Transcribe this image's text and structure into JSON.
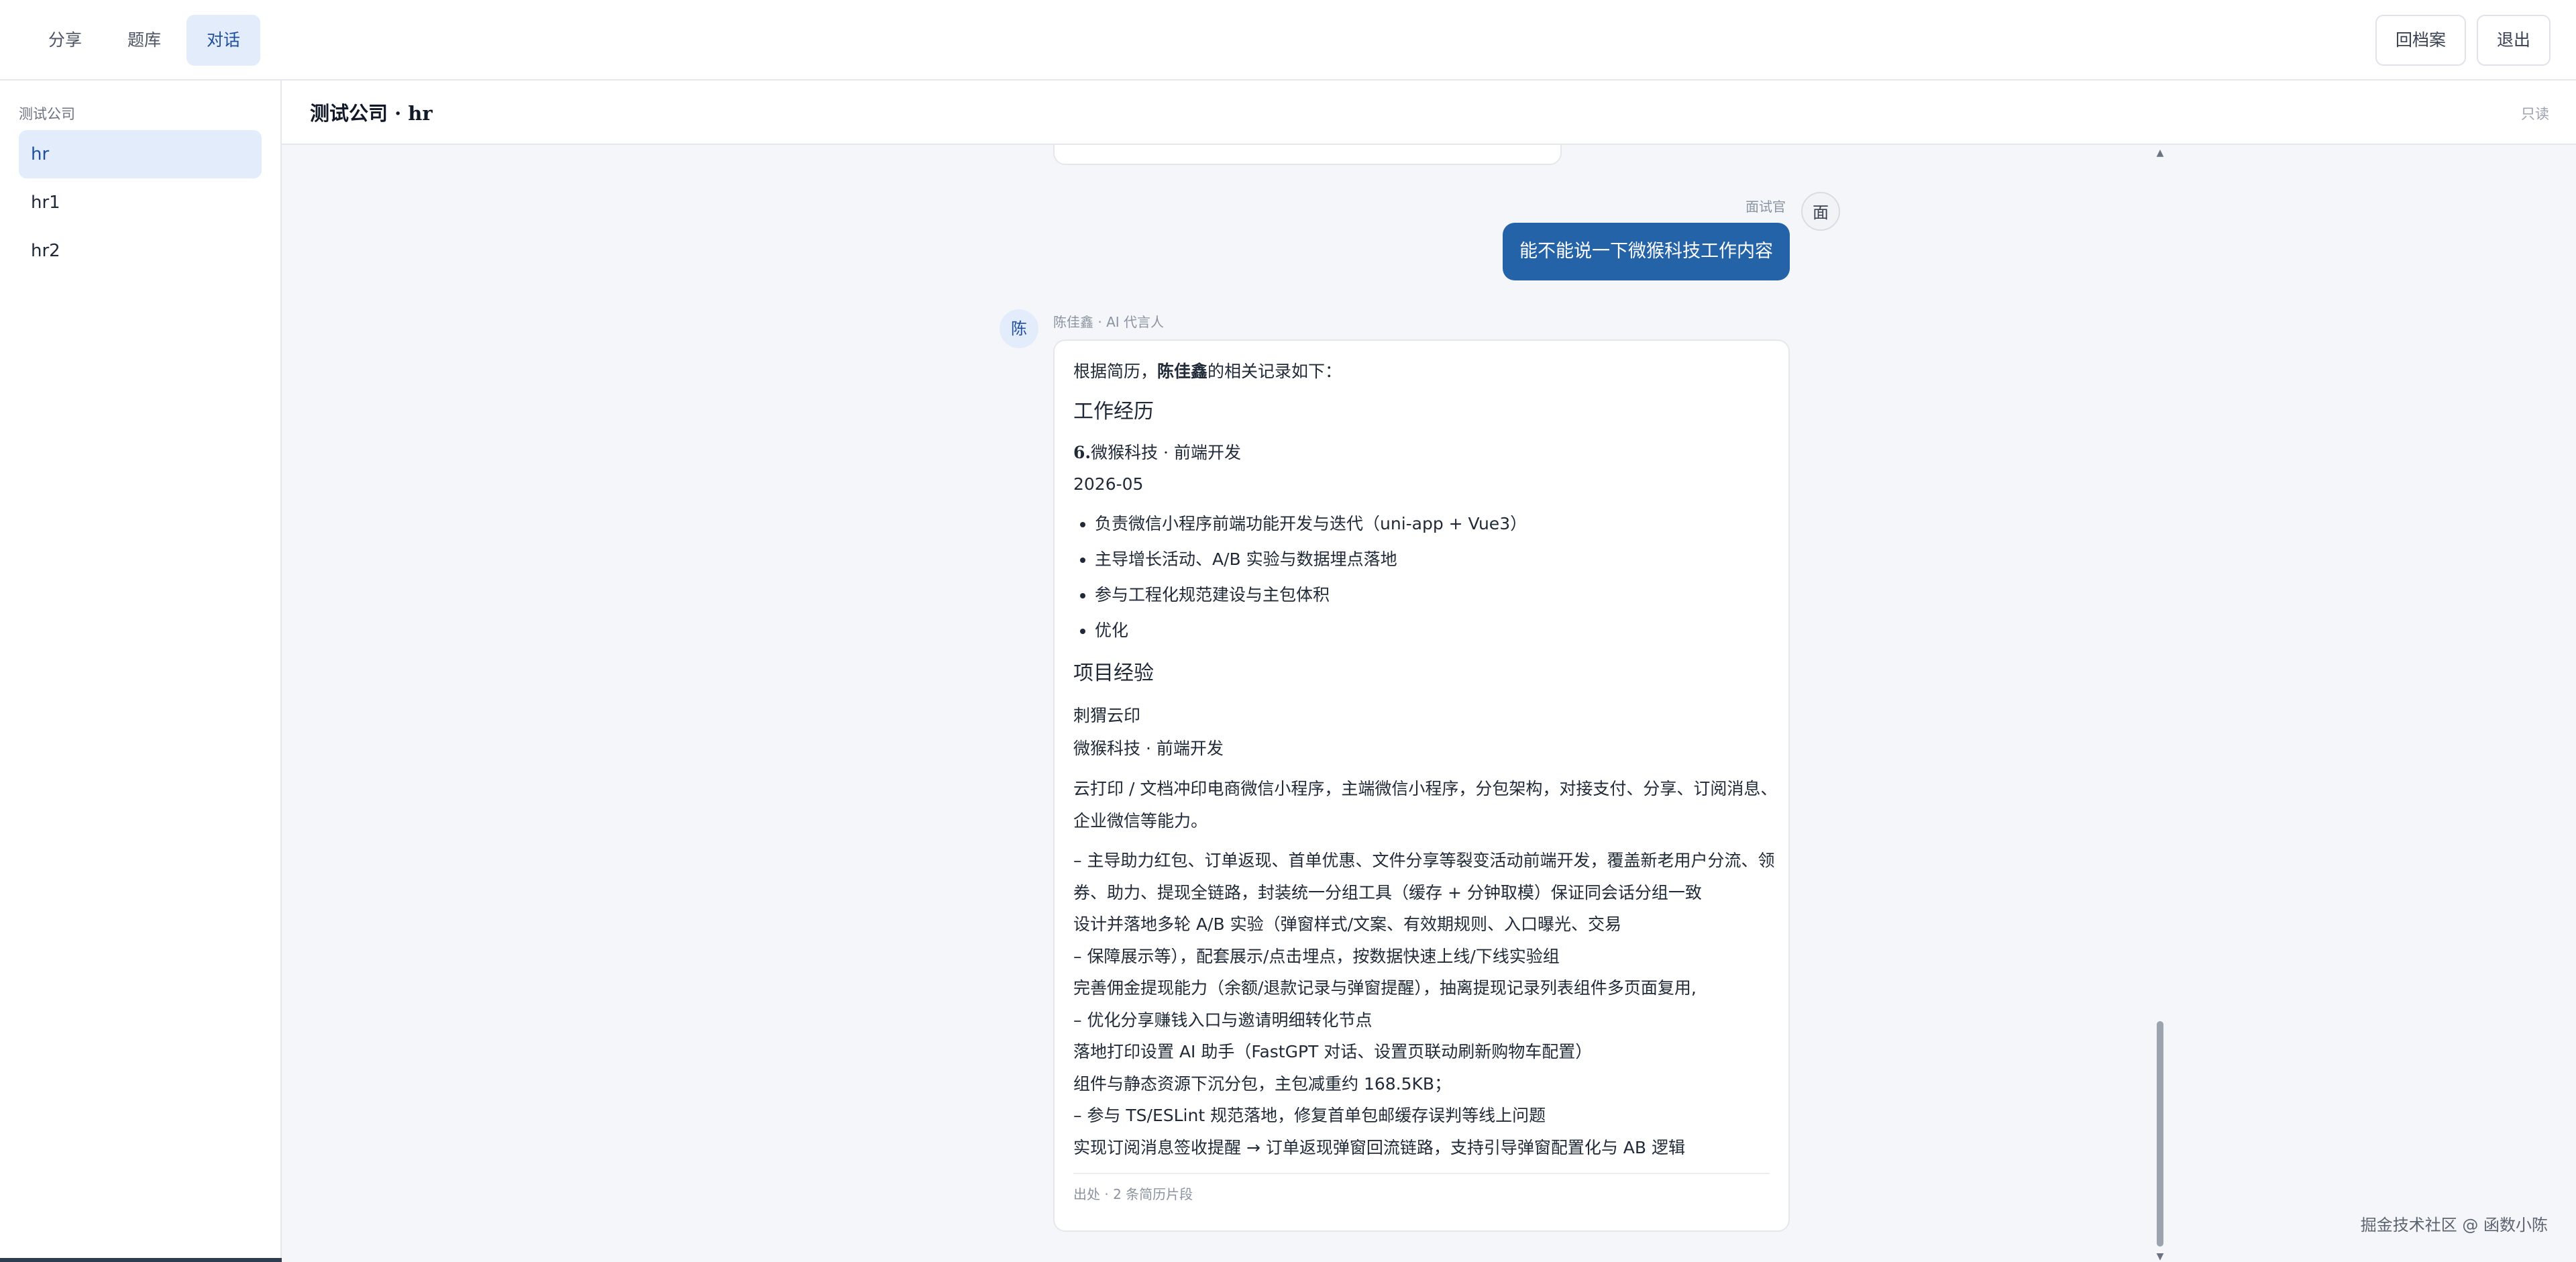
{
  "nav": {
    "tabs": [
      {
        "label": "分享"
      },
      {
        "label": "题库"
      },
      {
        "label": "对话",
        "active": true
      }
    ]
  },
  "top_actions": {
    "archive_label": "回档案",
    "logout_label": "退出"
  },
  "sidebar": {
    "group_label": "测试公司",
    "items": [
      {
        "label": "hr",
        "active": true
      },
      {
        "label": "hr1"
      },
      {
        "label": "hr2"
      }
    ]
  },
  "conversation": {
    "title": "测试公司 · hr",
    "mode_badge": "只读"
  },
  "messages": {
    "user": {
      "role": "面试官",
      "avatar": "面",
      "text": "能不能说一下微猴科技工作内容"
    },
    "ai": {
      "role": "陈佳鑫 · AI 代言人",
      "avatar": "陈",
      "intro_prefix": "根据简历，",
      "intro_name": "陈佳鑫",
      "intro_suffix": "的相关记录如下：",
      "work_heading": "工作经历",
      "job_number": "6.",
      "job_title": "微猴科技 · 前端开发",
      "job_date": "2026-05",
      "bullets": [
        "负责微信小程序前端功能开发与迭代（uni-app + Vue3）",
        "主导增长活动、A/B 实验与数据埋点落地",
        "参与工程化规范建设与主包体积",
        "优化"
      ],
      "project_heading": "项目经验",
      "project_name": "刺猬云印",
      "project_role": "微猴科技 · 前端开发",
      "project_desc": [
        "云打印 / 文档冲印电商微信小程序，主端微信小程序，分包架构，对接支付、分享、订阅消息、",
        "企业微信等能力。"
      ],
      "project_details": [
        "– 主导助力红包、订单返现、首单优惠、文件分享等裂变活动前端开发，覆盖新老用户分流、领",
        "券、助力、提现全链路，封装统一分组工具（缓存 + 分钟取模）保证同会话分组一致",
        "设计并落地多轮 A/B 实验（弹窗样式/文案、有效期规则、入口曝光、交易",
        "– 保障展示等），配套展示/点击埋点，按数据快速上线/下线实验组",
        "完善佣金提现能力（余额/退款记录与弹窗提醒），抽离提现记录列表组件多页面复用,",
        "– 优化分享赚钱入口与邀请明细转化节点",
        "落地打印设置 AI 助手（FastGPT 对话、设置页联动刷新购物车配置）",
        "组件与静态资源下沉分包，主包减重约 168.5KB；",
        "– 参与 TS/ESLint 规范落地，修复首单包邮缓存误判等线上问题",
        "实现订阅消息签收提醒 → 订单返现弹窗回流链路，支持引导弹窗配置化与 AB 逻辑"
      ],
      "source_note": "出处 · 2 条简历片段"
    }
  },
  "watermark": "掘金技术社区 @ 函数小陈"
}
